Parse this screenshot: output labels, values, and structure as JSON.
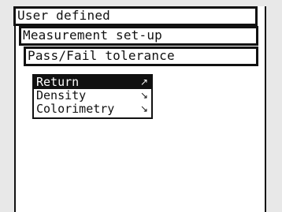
{
  "headers": {
    "level1": "User defined",
    "level2": "Measurement set-up",
    "level3": "Pass/Fail tolerance"
  },
  "menu": {
    "items": [
      {
        "label": "Return",
        "arrow": "↗",
        "selected": true
      },
      {
        "label": "Density",
        "arrow": "↘",
        "selected": false
      },
      {
        "label": "Colorimetry",
        "arrow": "↘",
        "selected": false
      }
    ]
  }
}
